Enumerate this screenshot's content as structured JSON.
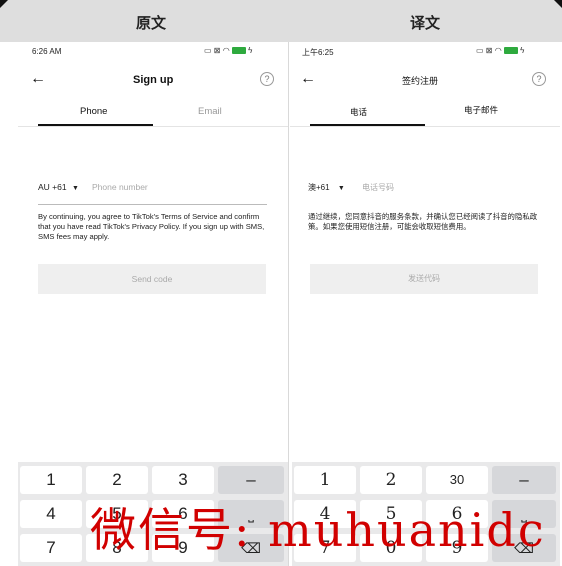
{
  "headers": {
    "left": "原文",
    "right": "译文"
  },
  "left": {
    "status_time": "6:26 AM",
    "nav_title": "Sign up",
    "tabs": [
      "Phone",
      "Email"
    ],
    "country_code": "AU +61",
    "phone_placeholder": "Phone number",
    "disclaimer": "By continuing, you agree to TikTok's Terms of Service and confirm that you have read TikTok's Privacy Policy. If you sign up with SMS, SMS fees may apply.",
    "send_button": "Send code",
    "keys": [
      "1",
      "2",
      "3",
      "–",
      "4",
      "5",
      "6",
      "⎵",
      "7",
      "8",
      "9",
      "⌫"
    ]
  },
  "right": {
    "status_time": "上午6:25",
    "nav_title": "签约注册",
    "tabs": [
      "电话",
      "电子邮件"
    ],
    "country_code": "澳+61",
    "phone_placeholder": "电话号码",
    "disclaimer": "通过继续，您同意抖音的服务条款，并确认您已经阅读了抖音的隐私政策。如果您使用短信注册，可能会收取短信费用。",
    "send_button": "发送代码",
    "keys": [
      "1",
      "2",
      "30",
      "–",
      "4",
      "5",
      "6",
      "⎵",
      "7",
      "0",
      "9",
      "⌫"
    ]
  },
  "watermark": "微信号: muhuanidc",
  "colors": {
    "header_bg": "#dedede",
    "battery": "#2eaa3e",
    "watermark": "#d10000"
  }
}
